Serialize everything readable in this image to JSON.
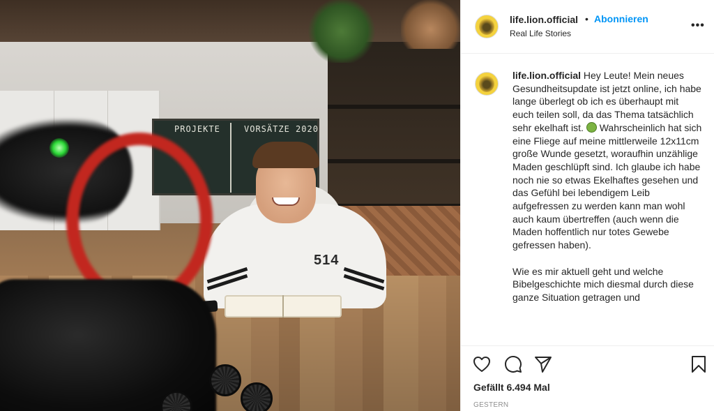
{
  "post": {
    "photo_alt": "",
    "photo_texts": {
      "chalkboard_left": "PROJEKTE",
      "chalkboard_right": "VORSÄTZE 2020",
      "hoodie_print": "514"
    }
  },
  "header": {
    "username": "life.lion.official",
    "separator": "•",
    "follow_label": "Abonnieren",
    "location": "Real Life Stories",
    "more_label": "•••"
  },
  "caption": {
    "username": "life.lion.official",
    "paragraph1_a": "Hey Leute! Mein neues Gesundheitsupdate ist jetzt online, ich habe lange überlegt ob ich es überhaupt mit euch teilen soll, da das Thema tatsächlich sehr ekelhaft ist. ",
    "paragraph1_b": " Wahrscheinlich hat sich eine Fliege auf meine mittlerweile 12x11cm große Wunde gesetzt, woraufhin unzählige Maden geschlüpft sind. Ich glaube ich habe noch nie so etwas Ekelhaftes gesehen und das Gefühl bei lebendigem Leib aufgefressen zu werden kann man wohl auch kaum übertreffen (auch wenn die Maden hoffentlich nur totes Gewebe gefressen haben).",
    "paragraph2": "Wie es mir aktuell geht und welche Bibelgeschichte mich diesmal durch diese ganze Situation getragen und"
  },
  "actions": {
    "likes": "Gefällt 6.494 Mal",
    "date": "GESTERN",
    "icons": [
      "heart-icon",
      "comment-icon",
      "share-icon",
      "bookmark-icon"
    ]
  },
  "colors": {
    "link_blue": "#0095f6",
    "text": "#262626",
    "muted": "#8e8e8e",
    "border": "#efefef"
  }
}
